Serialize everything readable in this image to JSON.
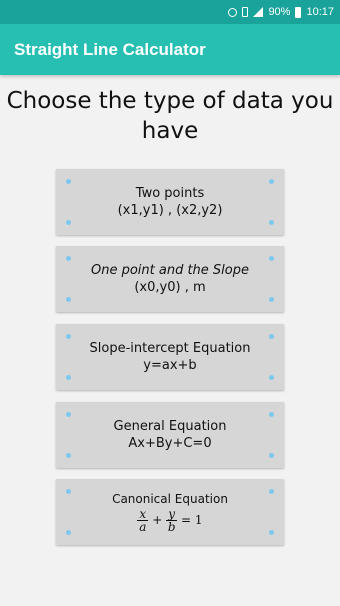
{
  "status_bar": {
    "battery": "90%",
    "time": "10:17"
  },
  "app_bar": {
    "title": "Straight Line Calculator"
  },
  "heading": "Choose the type of data you have",
  "options": [
    {
      "line1": "Two points",
      "line2": "(x1,y1) , (x2,y2)"
    },
    {
      "line1": "One point and the Slope",
      "line2": "(x0,y0) , m"
    },
    {
      "line1": "Slope-intercept Equation",
      "line2": "y=ax+b"
    },
    {
      "line1": "General Equation",
      "line2": "Ax+By+C=0"
    },
    {
      "line1": "Canonical Equation",
      "formula": {
        "x": "x",
        "a": "a",
        "plus": "+",
        "y": "y",
        "b": "b",
        "equals": "= 1"
      }
    }
  ]
}
